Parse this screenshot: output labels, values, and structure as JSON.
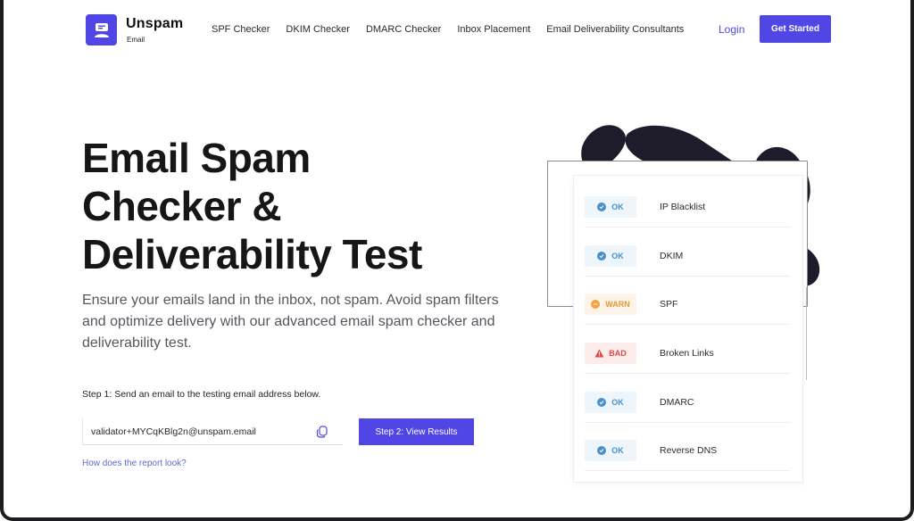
{
  "brand": {
    "name": "Unspam",
    "sub": "Email"
  },
  "nav": [
    "SPF Checker",
    "DKIM Checker",
    "DMARC Checker",
    "Inbox Placement",
    "Email Deliverability Consultants"
  ],
  "header": {
    "login": "Login",
    "cta": "Get Started"
  },
  "hero": {
    "title_line1": "Email Spam",
    "title_line2": "Checker &",
    "title_line3": "Deliverability Test",
    "description": "Ensure your emails land in the inbox, not spam. Avoid spam filters and optimize delivery with our advanced email spam checker and deliverability test.",
    "step1": "Step 1: Send an email to the testing email address below.",
    "email": "validator+MYCqKBlg2n@unspam.email",
    "step2_button": "Step 2: View Results",
    "report_link": "How does the report look?"
  },
  "results": [
    {
      "status": "OK",
      "label": "IP Blacklist",
      "kind": "ok"
    },
    {
      "status": "OK",
      "label": "DKIM",
      "kind": "ok"
    },
    {
      "status": "WARN",
      "label": "SPF",
      "kind": "warn"
    },
    {
      "status": "BAD",
      "label": "Broken Links",
      "kind": "bad"
    },
    {
      "status": "OK",
      "label": "DMARC",
      "kind": "ok"
    },
    {
      "status": "OK",
      "label": "Reverse DNS",
      "kind": "ok"
    }
  ],
  "colors": {
    "accent": "#4f46e5",
    "ok": "#4a90c8",
    "warn": "#f0a443",
    "bad": "#dc4a4a"
  },
  "icons": {
    "logo": "user-envelope-icon",
    "copy": "copy-icon",
    "ok": "check-circle-icon",
    "warn": "warning-circle-icon",
    "bad": "warning-triangle-icon"
  }
}
